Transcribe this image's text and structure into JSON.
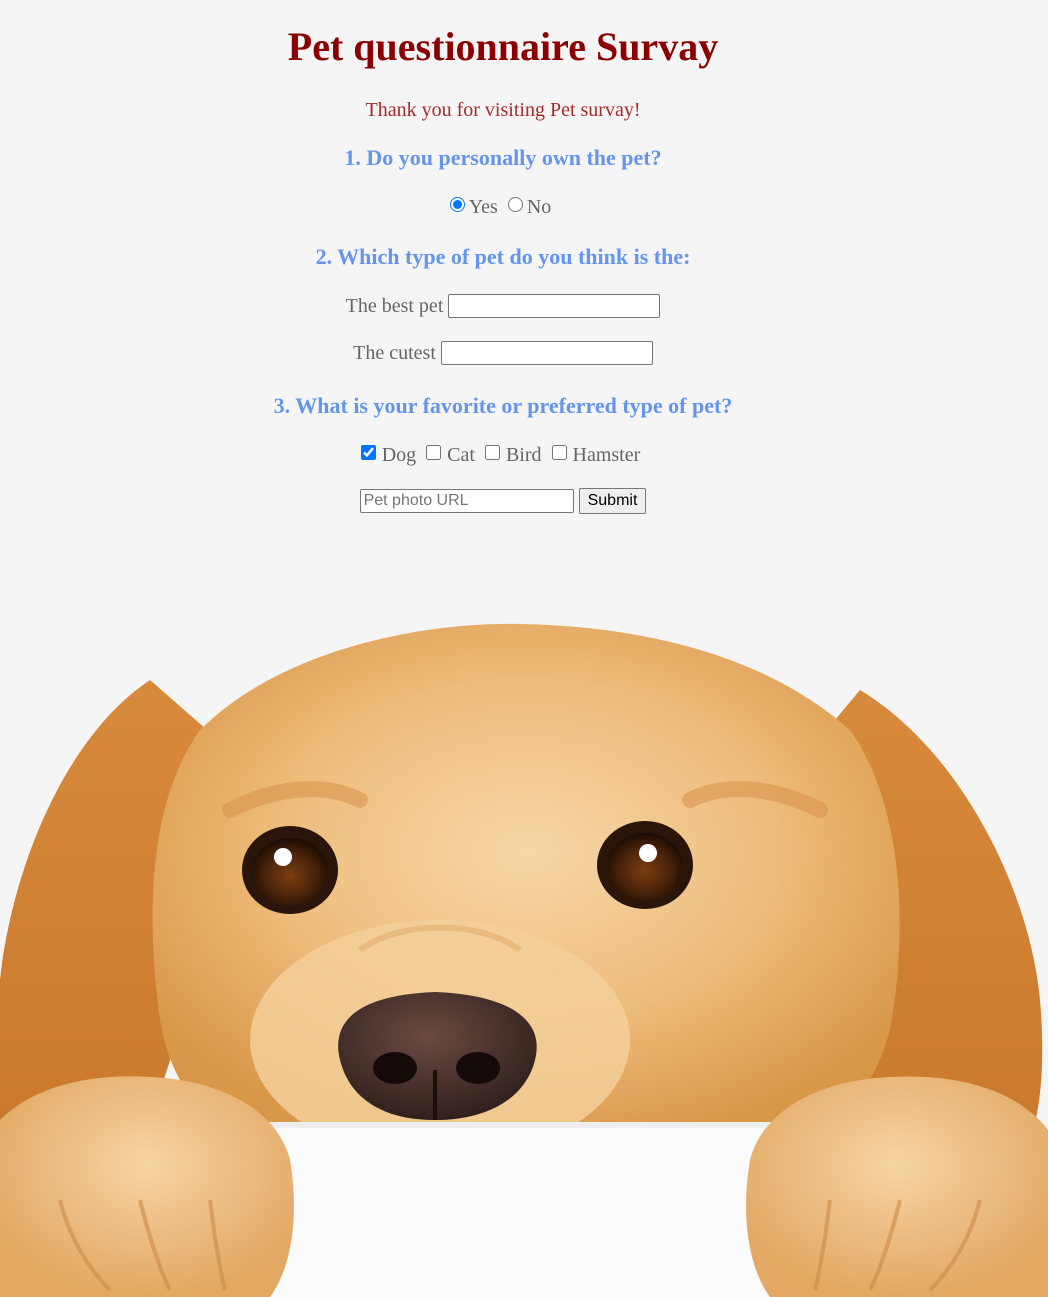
{
  "title": "Pet questionnaire Survay",
  "thanks": "Thank you for visiting Pet survay!",
  "q1": {
    "heading": "1. Do you personally own the pet?",
    "options": [
      {
        "label": "Yes",
        "selected": true
      },
      {
        "label": "No",
        "selected": false
      }
    ]
  },
  "q2": {
    "heading": "2. Which type of pet do you think is the:",
    "best_label": "The best pet",
    "best_value": "",
    "cutest_label": "The cutest",
    "cutest_value": ""
  },
  "q3": {
    "heading": "3. What is your favorite or preferred type of pet?",
    "options": [
      {
        "label": "Dog",
        "checked": true
      },
      {
        "label": "Cat",
        "checked": false
      },
      {
        "label": "Bird",
        "checked": false
      },
      {
        "label": "Hamster",
        "checked": false
      }
    ]
  },
  "photo": {
    "placeholder": "Pet photo URL",
    "value": "",
    "submit_label": "Submit"
  },
  "colors": {
    "title": "#8b0000",
    "thanks": "#a52a2a",
    "heading": "#6495ed",
    "background": "#f6f5f6"
  },
  "image": {
    "subject": "golden-retriever-peeking-over-table"
  }
}
